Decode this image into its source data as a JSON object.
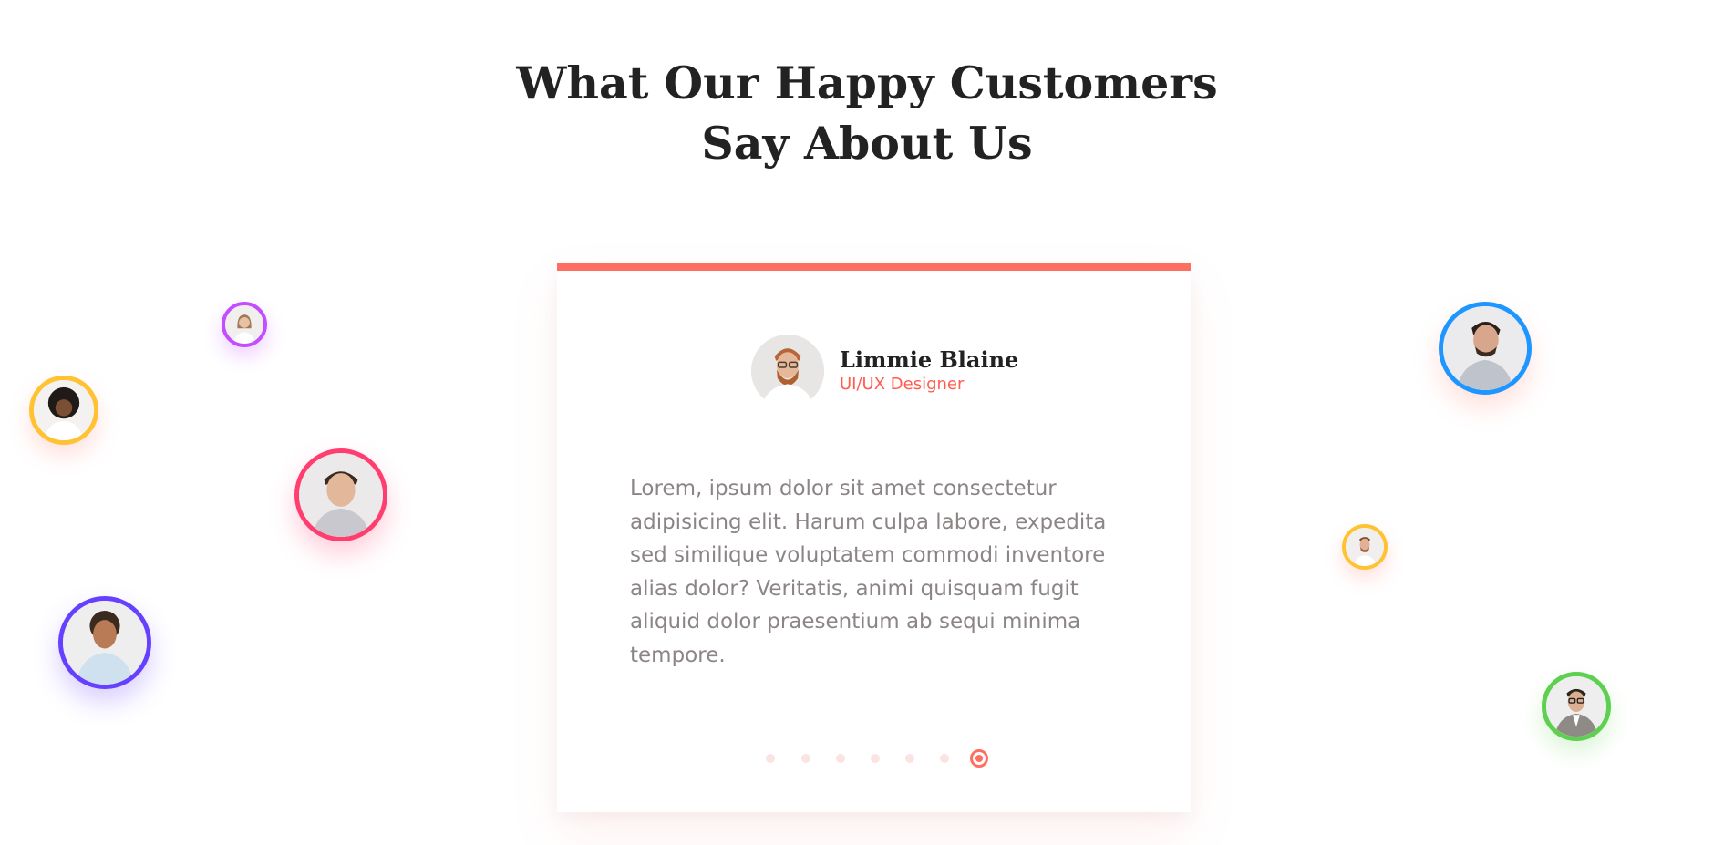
{
  "section": {
    "title_line1": "What Our Happy Customers",
    "title_line2": "Say About Us"
  },
  "testimonial": {
    "name": "Limmie Blaine",
    "role": "UI/UX Designer",
    "text": "Lorem, ipsum dolor sit amet consectetur adipisicing elit. Harum culpa labore, expedita sed similique voluptatem commodi inventore alias dolor? Veritatis, animi quisquam fugit aliquid dolor praesentium ab sequi minima tempore.",
    "accent_color": "#ff6f61"
  },
  "pagination": {
    "count": 7,
    "active_index": 6
  },
  "customer_avatars": [
    {
      "icon": "avatar-woman-small",
      "ring_color": "#c44dff"
    },
    {
      "icon": "avatar-woman-curly",
      "ring_color": "#ffc233"
    },
    {
      "icon": "avatar-man-smiling",
      "ring_color": "#ff3d6e"
    },
    {
      "icon": "avatar-man-curly",
      "ring_color": "#6640ff"
    },
    {
      "icon": "avatar-man-beard",
      "ring_color": "#1e96ff"
    },
    {
      "icon": "avatar-man-small",
      "ring_color": "#ffc233"
    },
    {
      "icon": "avatar-man-glasses",
      "ring_color": "#5ed04f"
    }
  ]
}
